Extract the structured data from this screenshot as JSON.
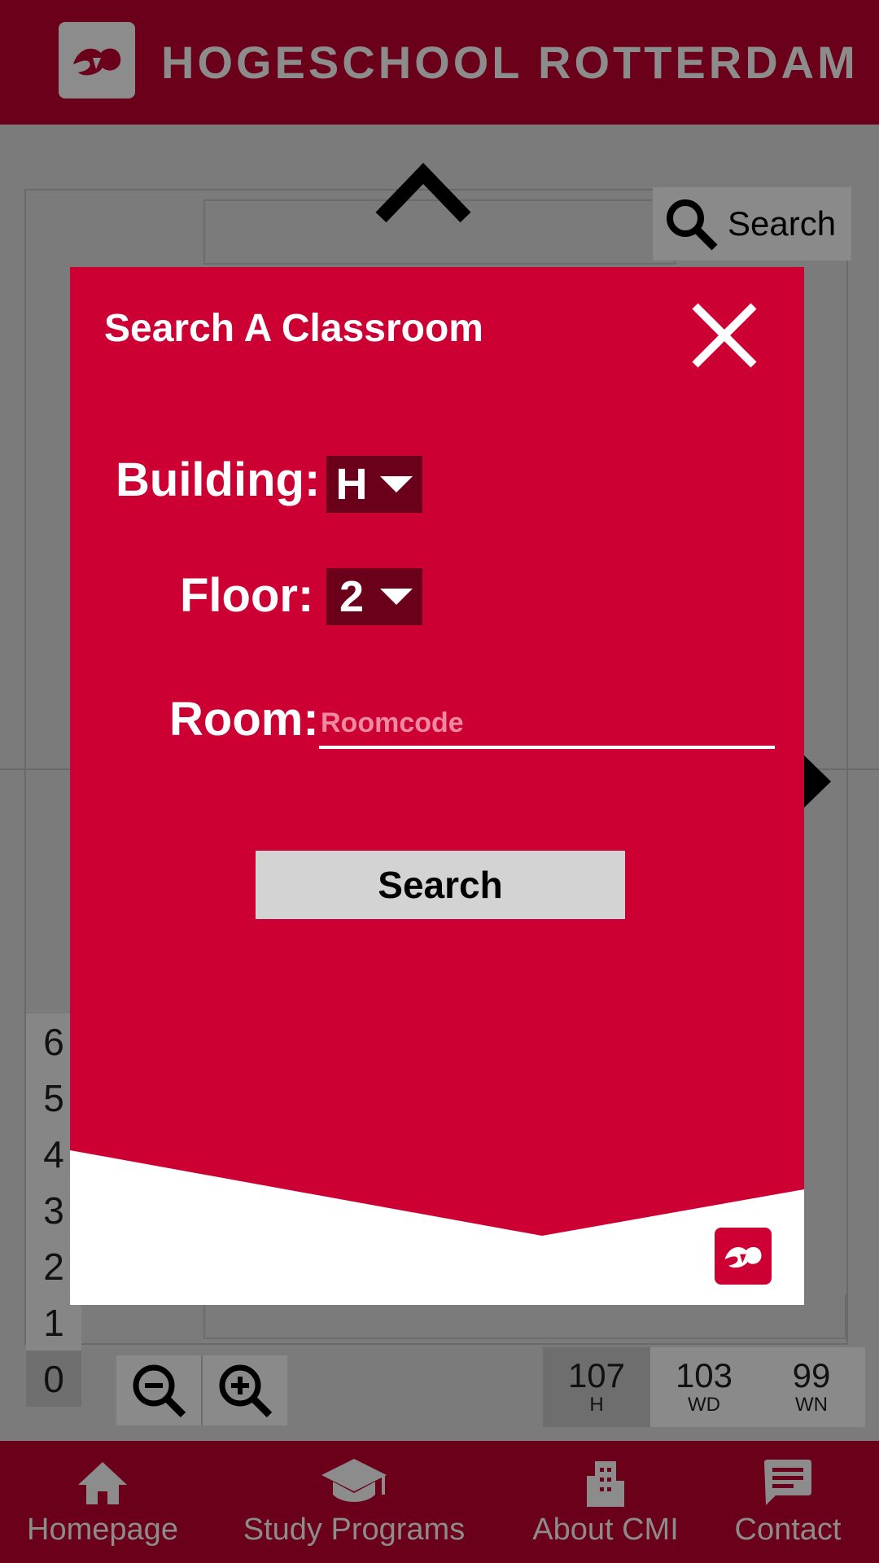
{
  "header": {
    "title": "HOGESCHOOL ROTTERDAM",
    "logo_icon": "hr-logo-icon"
  },
  "map": {
    "search_label": "Search",
    "floors": [
      "6",
      "5",
      "4",
      "3",
      "2",
      "1",
      "0"
    ],
    "active_floor": "0",
    "counts": [
      {
        "value": "107",
        "label": "H"
      },
      {
        "value": "103",
        "label": "WD"
      },
      {
        "value": "99",
        "label": "WN"
      }
    ]
  },
  "modal": {
    "title": "Search A Classroom",
    "building_label": "Building:",
    "building_value": "H",
    "floor_label": "Floor:",
    "floor_value": "2",
    "room_label": "Room:",
    "room_placeholder": "Roomcode",
    "search_button": "Search"
  },
  "bottom_nav": {
    "items": [
      {
        "label": "Homepage",
        "icon": "home-icon"
      },
      {
        "label": "Study Programs",
        "icon": "graduation-cap-icon"
      },
      {
        "label": "About CMI",
        "icon": "building-icon"
      },
      {
        "label": "Contact",
        "icon": "chat-icon"
      }
    ]
  },
  "colors": {
    "brand_dark": "#6a0019",
    "brand_red": "#cc0033",
    "overlay_gray": "#7b7b7b"
  }
}
